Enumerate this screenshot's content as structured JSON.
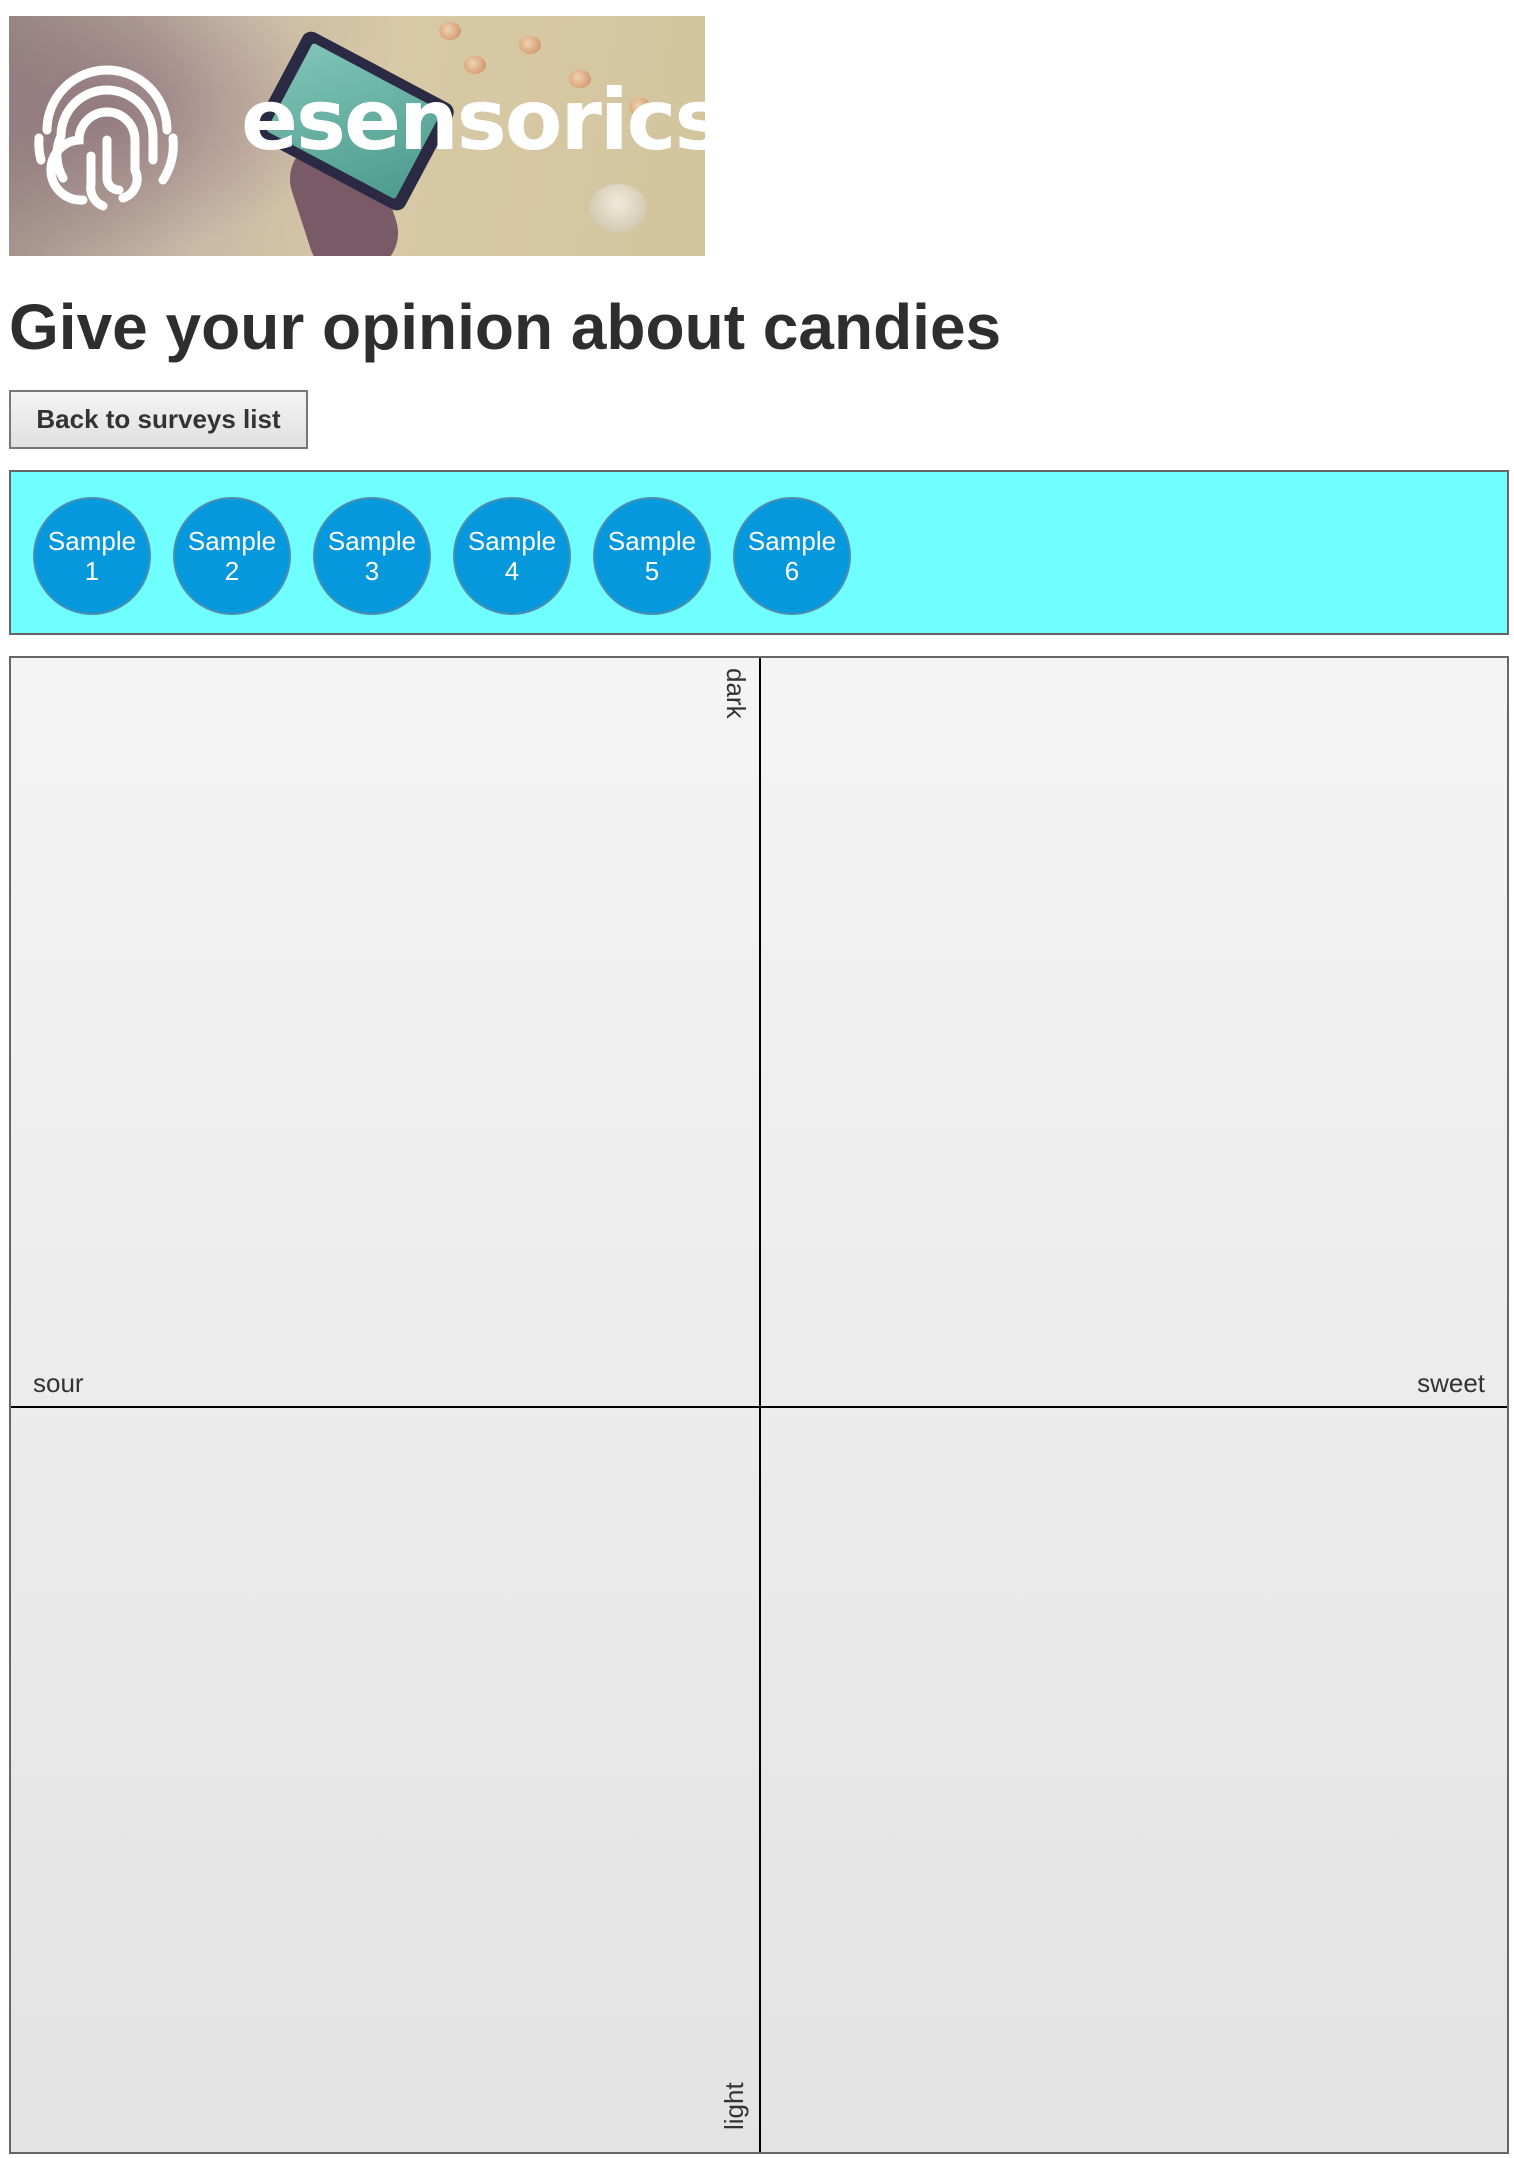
{
  "banner": {
    "brand": "esensorics",
    "logo_icon": "fingerprint-icon"
  },
  "page": {
    "title": "Give your opinion about candies"
  },
  "toolbar": {
    "back_label": "Back to surveys list"
  },
  "samples": [
    {
      "word": "Sample",
      "number": "1"
    },
    {
      "word": "Sample",
      "number": "2"
    },
    {
      "word": "Sample",
      "number": "3"
    },
    {
      "word": "Sample",
      "number": "4"
    },
    {
      "word": "Sample",
      "number": "5"
    },
    {
      "word": "Sample",
      "number": "6"
    }
  ],
  "map": {
    "left_label": "sour",
    "right_label": "sweet",
    "top_label": "dark",
    "bottom_label": "light"
  },
  "colors": {
    "samples_panel_bg": "#70ffff",
    "sample_bubble": "#0598dc",
    "map_bg": "#eeeeee"
  }
}
